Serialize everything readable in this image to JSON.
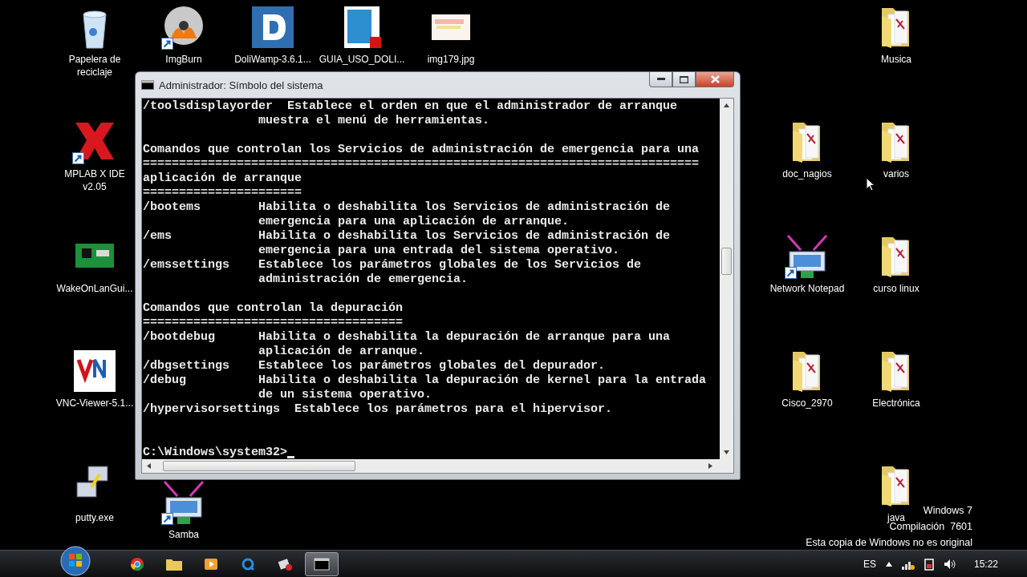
{
  "desktop_icons": [
    {
      "label": "Papelera de reciclaje",
      "kind": "recycle-bin"
    },
    {
      "label": "ImgBurn",
      "kind": "disc",
      "shortcut": true
    },
    {
      "label": "DoliWamp-3.6.1...",
      "kind": "letter-app"
    },
    {
      "label": "GUIA_USO_DOLI...",
      "kind": "pdf"
    },
    {
      "label": "img179.jpg",
      "kind": "image"
    },
    {
      "label": "Musica",
      "kind": "folder"
    },
    {
      "label": "MPLAB X IDE v2.05",
      "kind": "cross-app",
      "shortcut": true
    },
    {
      "label": "doc_nagios",
      "kind": "folder"
    },
    {
      "label": "varios",
      "kind": "folder"
    },
    {
      "label": "WakeOnLanGui...",
      "kind": "board"
    },
    {
      "label": "Network Notepad",
      "kind": "network",
      "shortcut": true
    },
    {
      "label": "curso linux",
      "kind": "folder"
    },
    {
      "label": "VNC-Viewer-5.1...",
      "kind": "vnc"
    },
    {
      "label": "Cisco_2970",
      "kind": "folder"
    },
    {
      "label": "Electrónica",
      "kind": "folder"
    },
    {
      "label": "putty.exe",
      "kind": "terminals"
    },
    {
      "label": "Samba",
      "kind": "network",
      "shortcut": true
    },
    {
      "label": "java",
      "kind": "folder"
    }
  ],
  "window": {
    "title": "Administrador: Símbolo del sistema",
    "console_paragraphs": [
      [
        "/toolsdisplayorder  Establece el orden en que el administrador de arranque",
        "                muestra el menú de herramientas."
      ],
      [
        "Comandos que controlan los Servicios de administración de emergencia para una",
        "=============================================================================",
        "aplicación de arranque",
        "======================",
        "/bootems        Habilita o deshabilita los Servicios de administración de",
        "                emergencia para una aplicación de arranque.",
        "/ems            Habilita o deshabilita los Servicios de administración de",
        "                emergencia para una entrada del sistema operativo.",
        "/emssettings    Establece los parámetros globales de los Servicios de",
        "                administración de emergencia."
      ],
      [
        "Comandos que controlan la depuración",
        "====================================",
        "/bootdebug      Habilita o deshabilita la depuración de arranque para una",
        "                aplicación de arranque.",
        "/dbgsettings    Establece los parámetros globales del depurador.",
        "/debug          Habilita o deshabilita la depuración de kernel para la entrada",
        "                de un sistema operativo.",
        "/hypervisorsettings  Establece los parámetros para el hipervisor."
      ]
    ],
    "prompt": "C:\\Windows\\system32>"
  },
  "watermark_lines": [
    "Windows 7",
    "Compilación  7601",
    "Esta copia de Windows no es original"
  ],
  "taskbar": {
    "apps": [
      {
        "kind": "browser",
        "selected": false
      },
      {
        "kind": "explorer",
        "selected": false
      },
      {
        "kind": "media",
        "selected": false
      },
      {
        "kind": "q-app",
        "selected": false
      },
      {
        "kind": "network-tool",
        "selected": false
      },
      {
        "kind": "console",
        "selected": true
      }
    ],
    "language": "ES",
    "clock": "15:22"
  }
}
